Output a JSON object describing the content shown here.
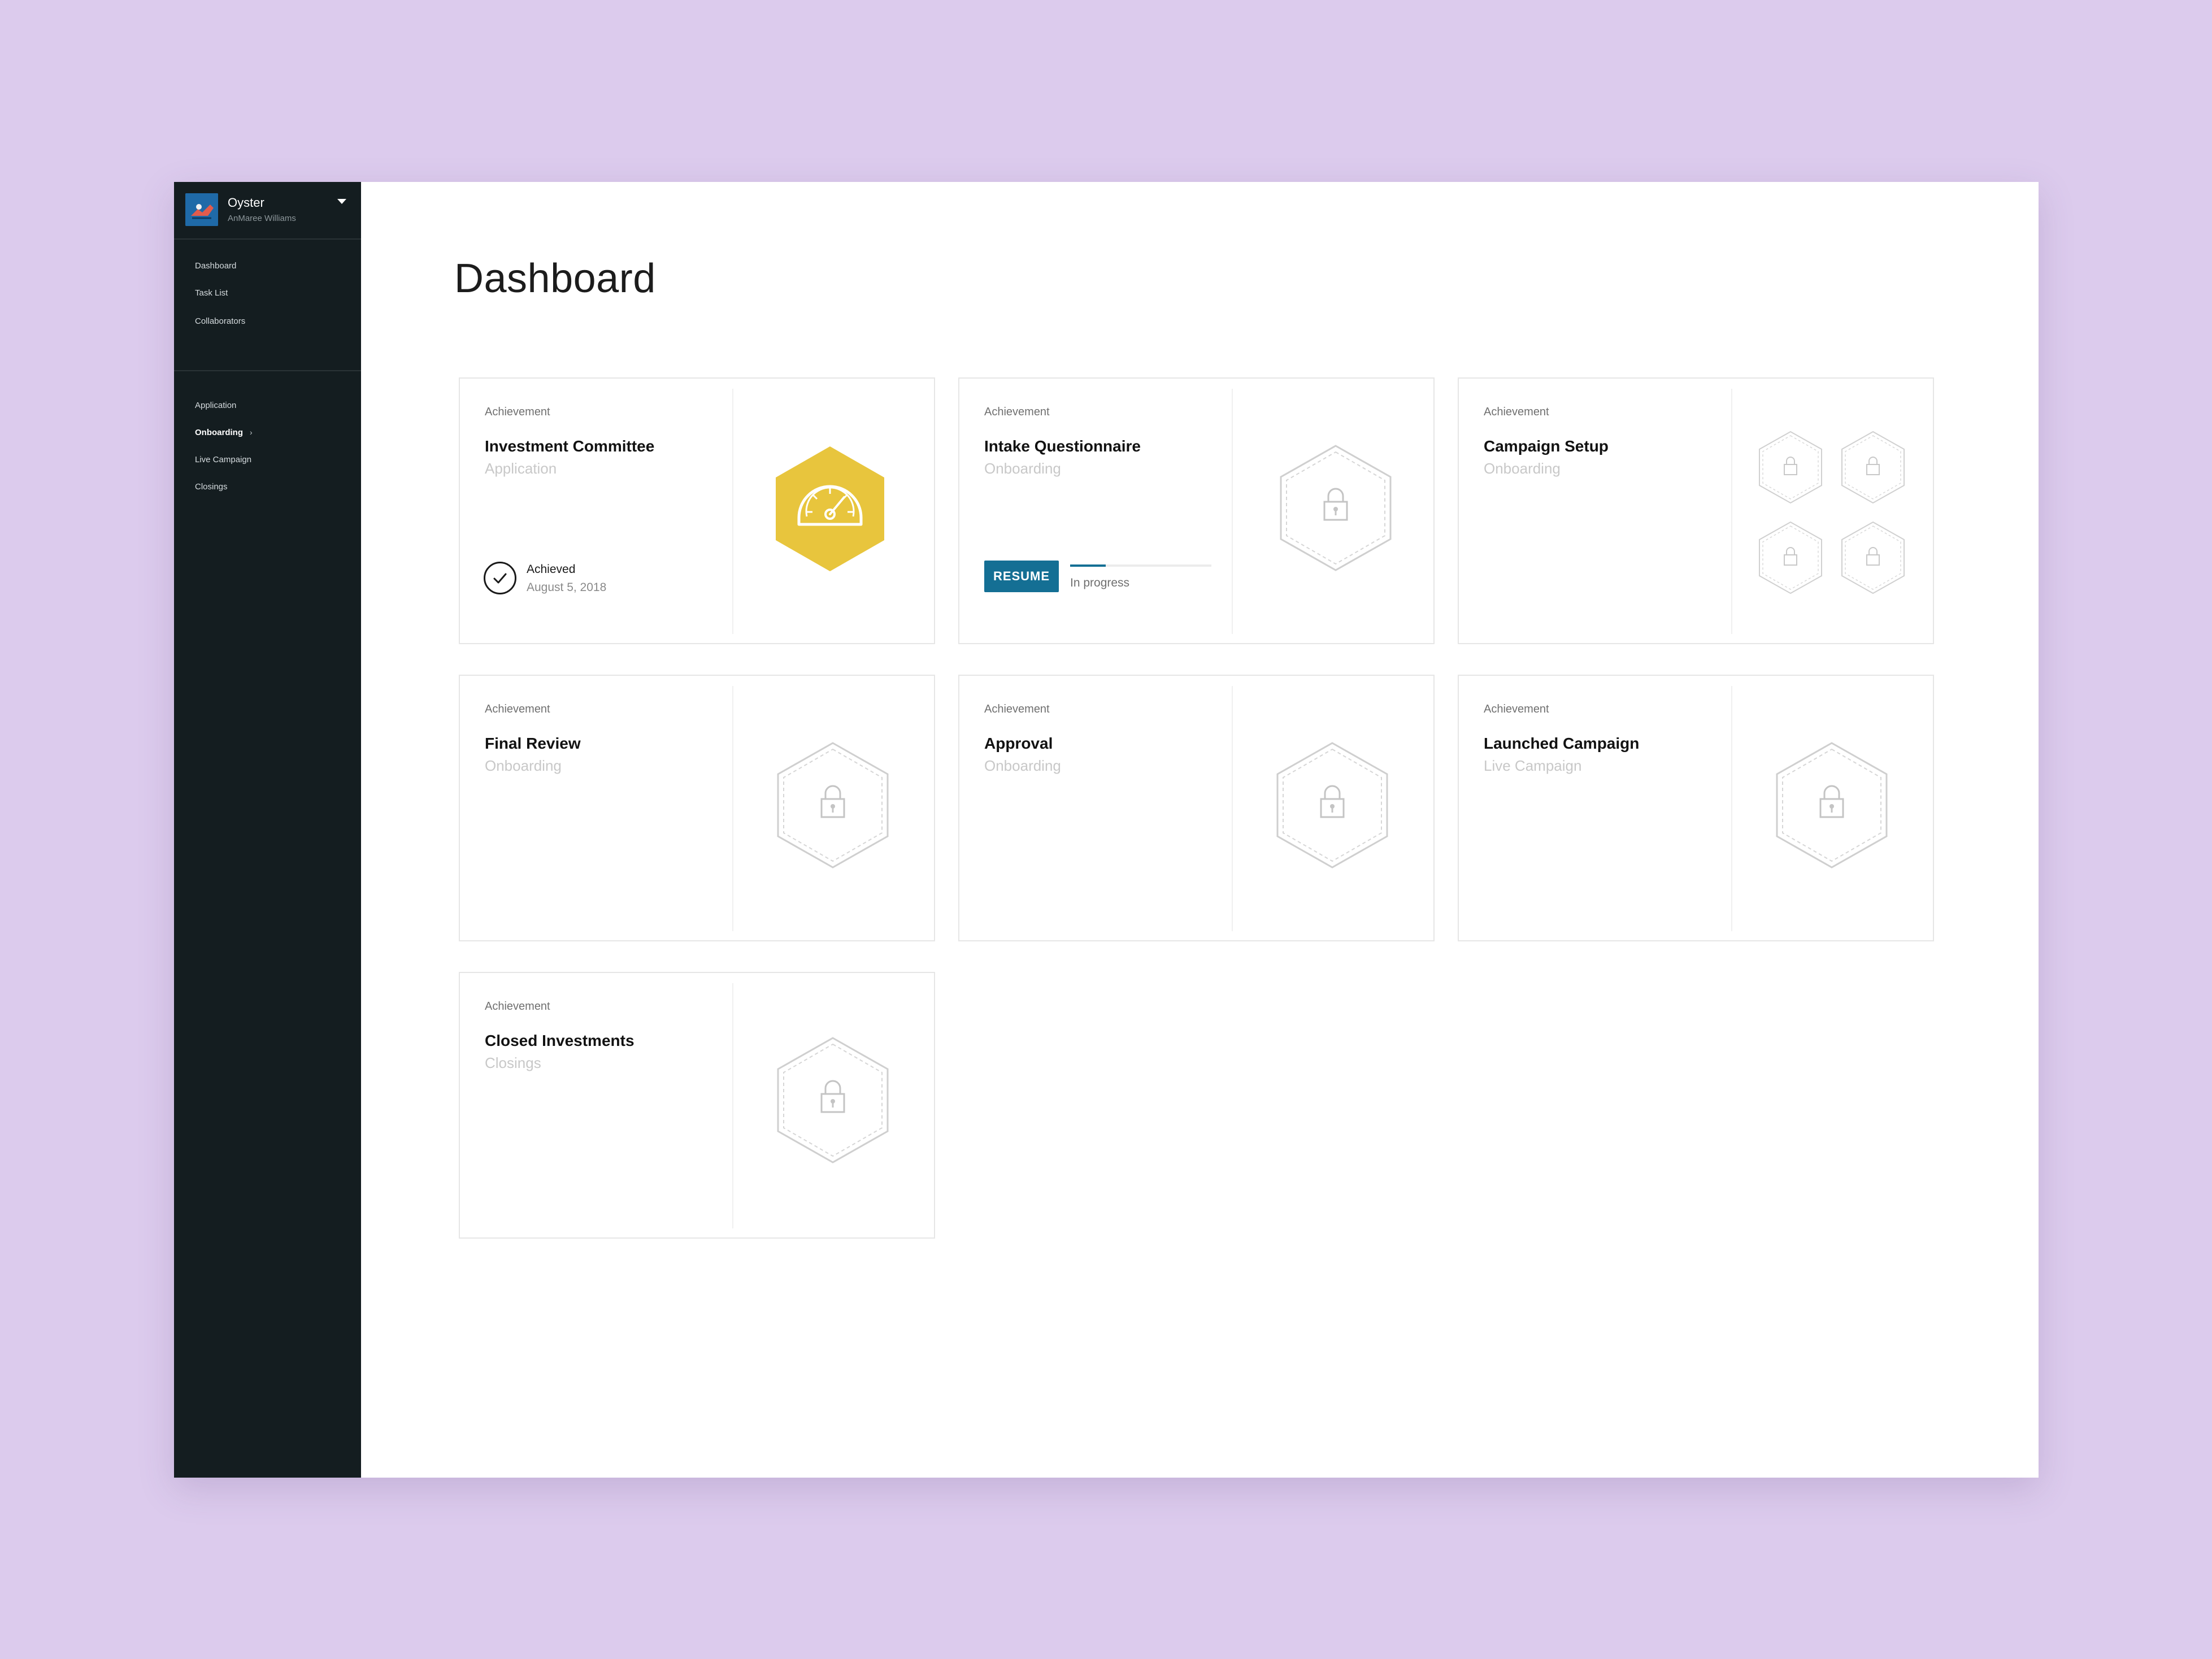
{
  "account": {
    "name": "Oyster",
    "user": "AnMaree Williams"
  },
  "nav_primary": [
    "Dashboard",
    "Task List",
    "Collaborators"
  ],
  "nav_secondary": [
    {
      "label": "Application",
      "active": false
    },
    {
      "label": "Onboarding",
      "active": true,
      "chevron": "›"
    },
    {
      "label": "Live Campaign",
      "active": false
    },
    {
      "label": "Closings",
      "active": false
    }
  ],
  "page": {
    "title": "Dashboard"
  },
  "colors": {
    "accent": "#146f94",
    "badge_gold": "#e8c53d",
    "sidebar": "#141d20",
    "background": "#dccbed"
  },
  "cards": [
    {
      "kind": "Achievement",
      "title": "Investment Committee",
      "subtitle": "Application",
      "status": "achieved",
      "achieved_label": "Achieved",
      "achieved_date": "August 5, 2018",
      "badge_icon": "speedometer-icon"
    },
    {
      "kind": "Achievement",
      "title": "Intake Questionnaire",
      "subtitle": "Onboarding",
      "status": "in_progress",
      "button_label": "RESUME",
      "progress_label": "In progress",
      "progress": 0.25,
      "badge_icon": "lock-icon"
    },
    {
      "kind": "Achievement",
      "title": "Campaign Setup",
      "subtitle": "Onboarding",
      "status": "locked",
      "badge_icon": "lock-icon",
      "badge_count": 4
    },
    {
      "kind": "Achievement",
      "title": "Final Review",
      "subtitle": "Onboarding",
      "status": "locked",
      "badge_icon": "lock-icon"
    },
    {
      "kind": "Achievement",
      "title": "Approval",
      "subtitle": "Onboarding",
      "status": "locked",
      "badge_icon": "lock-icon"
    },
    {
      "kind": "Achievement",
      "title": "Launched Campaign",
      "subtitle": "Live Campaign",
      "status": "locked",
      "badge_icon": "lock-icon"
    },
    {
      "kind": "Achievement",
      "title": "Closed Investments",
      "subtitle": "Closings",
      "status": "locked",
      "badge_icon": "lock-icon"
    }
  ]
}
